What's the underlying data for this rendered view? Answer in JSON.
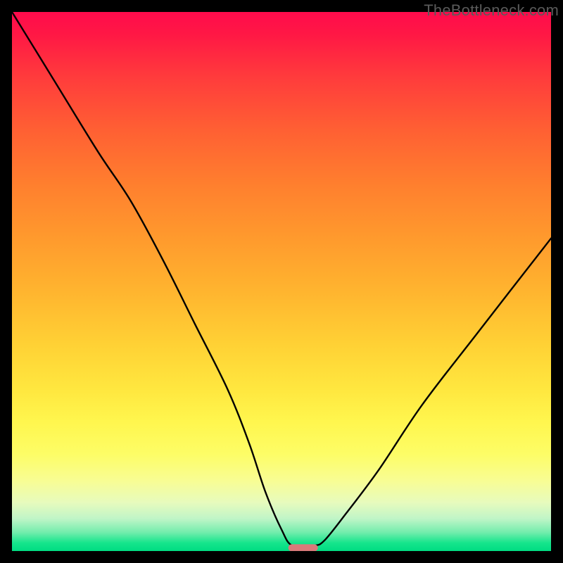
{
  "watermark": "TheBottleneck.com",
  "chart_data": {
    "type": "line",
    "title": "",
    "xlabel": "",
    "ylabel": "",
    "xlim": [
      0,
      100
    ],
    "ylim": [
      0,
      100
    ],
    "grid": false,
    "legend": false,
    "series": [
      {
        "name": "bottleneck-curve",
        "x": [
          0,
          8,
          16,
          22,
          28,
          34,
          40,
          44,
          47,
          50,
          52,
          56,
          58,
          62,
          68,
          76,
          86,
          100
        ],
        "y": [
          100,
          87,
          74,
          65,
          54,
          42,
          30,
          20,
          11,
          4,
          1,
          1,
          2,
          7,
          15,
          27,
          40,
          58
        ]
      }
    ],
    "marker": {
      "name": "optimal-marker",
      "x": 54,
      "y": 0.6,
      "width_pct": 5.5,
      "height_pct": 1.3,
      "color": "#d97a7a"
    },
    "background_gradient": {
      "stops": [
        {
          "pct": 0,
          "color": "#ff0b4c"
        },
        {
          "pct": 4,
          "color": "#ff1745"
        },
        {
          "pct": 12,
          "color": "#ff3b3c"
        },
        {
          "pct": 22,
          "color": "#ff6033"
        },
        {
          "pct": 32,
          "color": "#ff7f2e"
        },
        {
          "pct": 42,
          "color": "#ff9a2d"
        },
        {
          "pct": 52,
          "color": "#ffb52f"
        },
        {
          "pct": 62,
          "color": "#ffd235"
        },
        {
          "pct": 70,
          "color": "#ffe73f"
        },
        {
          "pct": 76,
          "color": "#fff64e"
        },
        {
          "pct": 82,
          "color": "#fdfd66"
        },
        {
          "pct": 87,
          "color": "#f8fd94"
        },
        {
          "pct": 91,
          "color": "#e7fbbd"
        },
        {
          "pct": 94,
          "color": "#c0f5c7"
        },
        {
          "pct": 96.5,
          "color": "#74edad"
        },
        {
          "pct": 98.5,
          "color": "#15e58c"
        },
        {
          "pct": 100,
          "color": "#00dc82"
        }
      ]
    }
  }
}
